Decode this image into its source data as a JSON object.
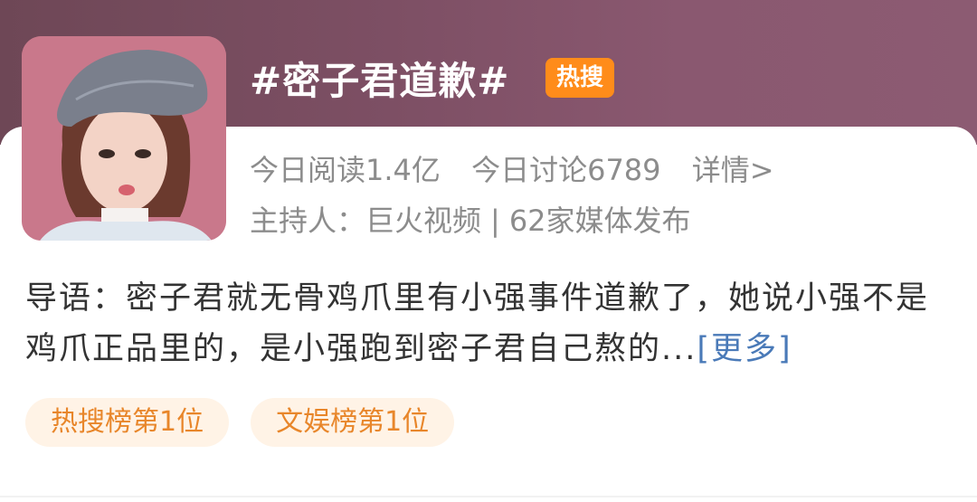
{
  "topic": {
    "title": "#密子君道歉#",
    "badge": "热搜",
    "badge_color": "#ff8c1a"
  },
  "stats": {
    "reads": "今日阅读1.4亿",
    "discussions": "今日讨论6789",
    "details_link": "详情>"
  },
  "host": {
    "label": "主持人：",
    "name": "巨火视频",
    "separator": "|",
    "media": "62家媒体发布"
  },
  "intro": {
    "text": "导语：密子君就无骨鸡爪里有小强事件道歉了，她说小强不是鸡爪正品里的，是小强跑到密子君自己熬的...",
    "more_link": "[更多]"
  },
  "tags": [
    {
      "label": "热搜榜第1位"
    },
    {
      "label": "文娱榜第1位"
    }
  ],
  "avatar": {
    "icon": "person-avatar"
  }
}
